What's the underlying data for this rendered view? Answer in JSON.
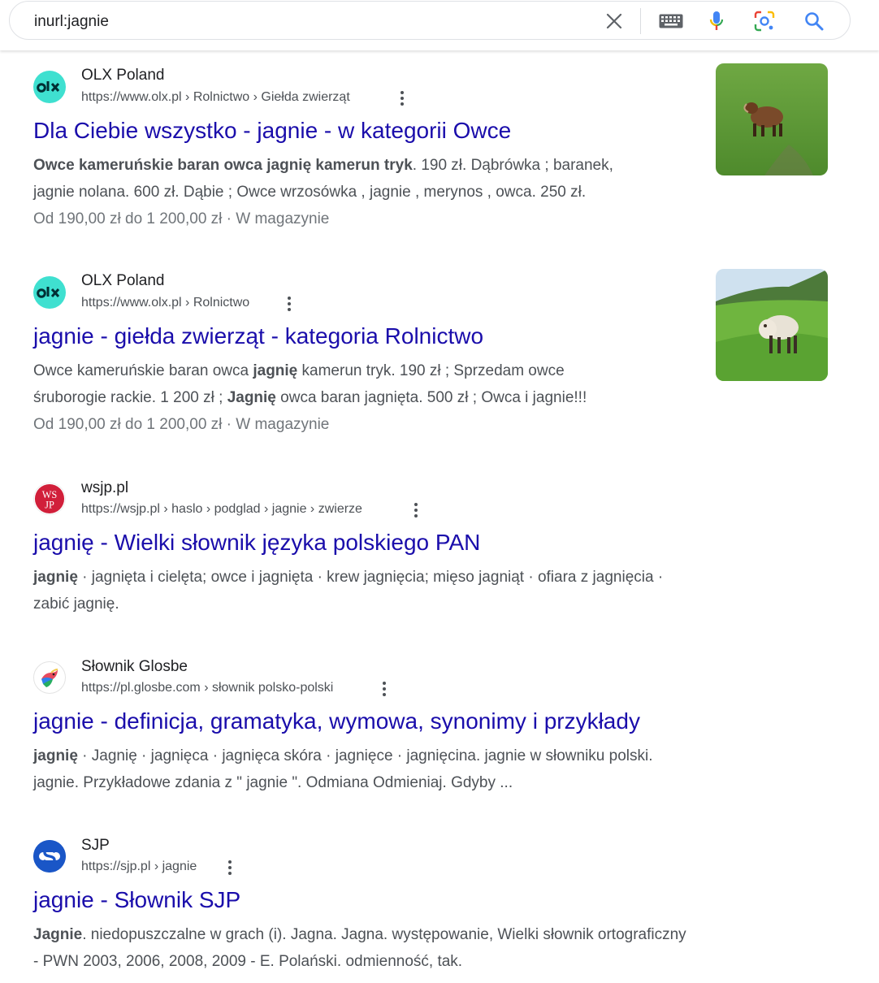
{
  "search": {
    "query": "inurl:jagnie"
  },
  "results": [
    {
      "site_name": "OLX Poland",
      "url": "https://www.olx.pl › Rolnictwo › Giełda zwierząt",
      "title": "Dla Ciebie wszystko - jagnie - w kategorii Owce",
      "snippet_line1_bold": "Owce kameruńskie baran owca jagnię kamerun tryk",
      "snippet_line1_rest": ". 190 zł. Dąbrówka ; baranek,",
      "snippet_line2": "jagnie nolana. 600 zł. Dąbie ; Owce wrzosówka , jagnie , merynos , owca. 250 zł.",
      "meta": "Od 190,00 zł do 1 200,00 zł · W magazynie"
    },
    {
      "site_name": "OLX Poland",
      "url": "https://www.olx.pl › Rolnictwo",
      "title": "jagnie - giełda zwierząt - kategoria Rolnictwo",
      "snippet_line1_pre": "Owce kameruńskie baran owca ",
      "snippet_line1_bold": "jagnię",
      "snippet_line1_post": " kamerun tryk. 190 zł ; Sprzedam owce",
      "snippet_line2_pre": "śruborogie rackie. 1 200 zł ; ",
      "snippet_line2_bold": "Jagnię",
      "snippet_line2_post": " owca baran jagnięta. 500 zł ; Owca i jagnie!!!",
      "meta": "Od 190,00 zł do 1 200,00 zł · W magazynie"
    },
    {
      "site_name": "wsjp.pl",
      "favicon_text": "WSJP",
      "url": "https://wsjp.pl › haslo › podglad › jagnie › zwierze",
      "title": "jagnię - Wielki słownik języka polskiego PAN",
      "snippet_line1_bold": "jagnię",
      "snippet_line1_rest": " · jagnięta i cielęta; owce i jagnięta · krew jagnięcia; mięso jagniąt · ofiara z jagnięcia ·",
      "snippet_line2": "zabić jagnię."
    },
    {
      "site_name": "Słownik Glosbe",
      "url": "https://pl.glosbe.com › słownik polsko-polski",
      "title": "jagnie - definicja, gramatyka, wymowa, synonimy i przykłady",
      "snippet_line1_bold": "jagnię",
      "snippet_line1_rest": " · Jagnię · jagnięca · jagnięca skóra · jagnięce · jagnięcina. jagnie w słowniku polski.",
      "snippet_line2": "jagnie. Przykładowe zdania z \" jagnie \". Odmiana Odmieniaj. Gdyby ..."
    },
    {
      "site_name": "SJP",
      "url": "https://sjp.pl › jagnie",
      "title": "jagnie - Słownik SJP",
      "snippet_line1_bold": "Jagnie",
      "snippet_line1_rest": ". niedopuszczalne w grach (i). Jagna. Jagna. występowanie, Wielki słownik ortograficzny",
      "snippet_line2": "- PWN 2003, 2006, 2008, 2009 - E. Polański. odmienność, tak."
    }
  ],
  "colors": {
    "link": "#1a0dab",
    "text": "#4d5156",
    "olx_teal": "#3fe0d0",
    "sjp_blue": "#1a56c7",
    "wsjp_red": "#d11f3a"
  }
}
